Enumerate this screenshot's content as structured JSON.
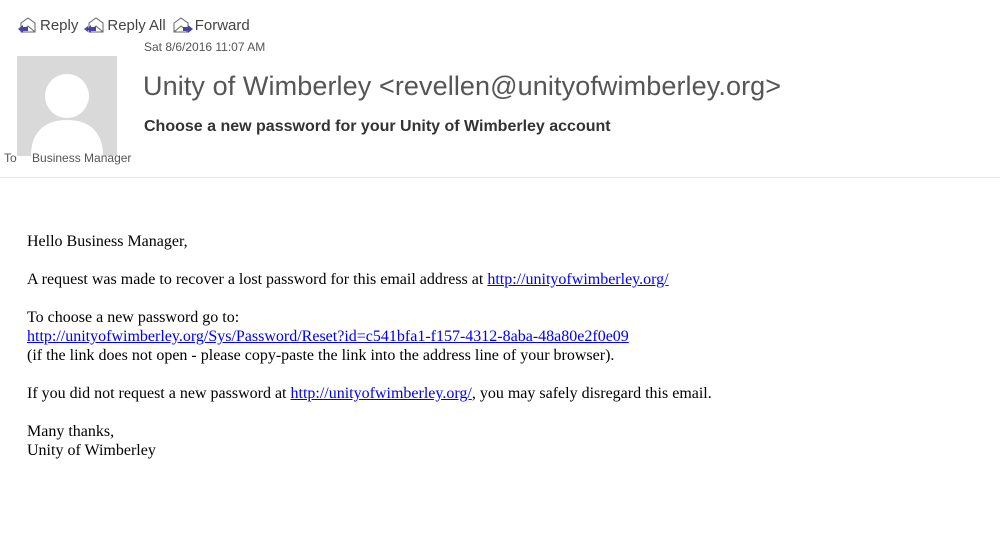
{
  "toolbar": {
    "reply": "Reply",
    "reply_all": "Reply All",
    "forward": "Forward"
  },
  "header": {
    "date": "Sat 8/6/2016 11:07 AM",
    "sender": "Unity of Wimberley <revellen@unityofwimberley.org>",
    "subject": "Choose a new password for your Unity of Wimberley account",
    "to_label": "To",
    "to_value": "Business Manager"
  },
  "body": {
    "greeting": "Hello Business Manager,",
    "p1_text": "A request was made to recover a lost password for this email address at ",
    "p1_link": "http://unityofwimberley.org/",
    "p2_line1": "To choose a new password go to:",
    "p2_link": "http://unityofwimberley.org/Sys/Password/Reset?id=c541bfa1-f157-4312-8aba-48a80e2f0e09",
    "p2_line3": "(if the link does not open - please copy-paste the link into the address line of your browser).",
    "p3_text_before": "If you did not request a new password at ",
    "p3_link": "http://unityofwimberley.org/",
    "p3_text_after": ", you may safely disregard this email.",
    "closing_line1": "Many thanks,",
    "closing_line2": "Unity of Wimberley"
  },
  "icons": {
    "reply": "reply-icon",
    "reply_all": "reply-all-icon",
    "forward": "forward-icon",
    "avatar": "default-avatar-icon"
  },
  "colors": {
    "link": "#0000ee",
    "icon_arrow": "#4b3fa8",
    "avatar_bg": "#d9d9d9"
  }
}
